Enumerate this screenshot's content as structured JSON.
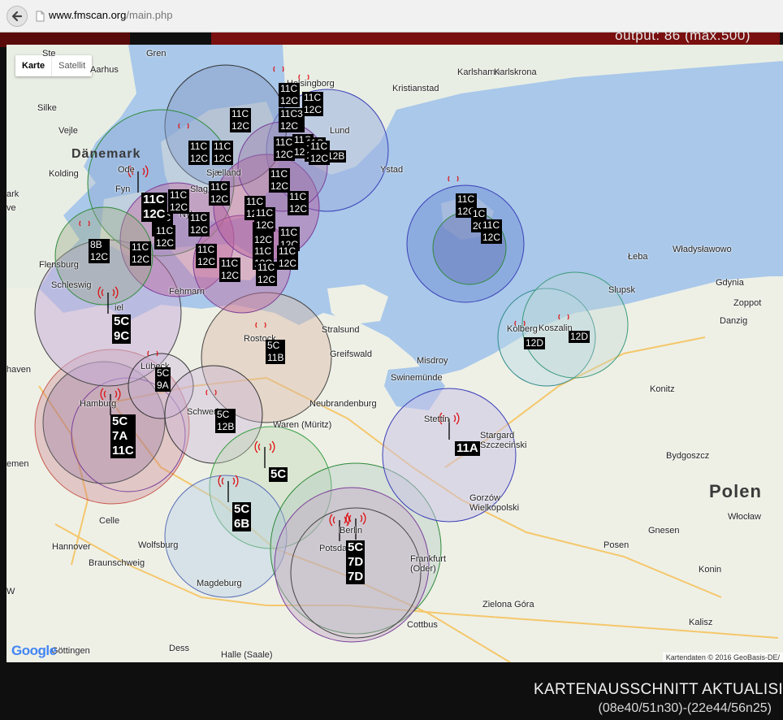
{
  "browser": {
    "url_domain": "www.fmscan.org",
    "url_path": "/main.php"
  },
  "counter_text": "output: 86 (max.500)",
  "map": {
    "type_buttons": [
      "Karte",
      "Satellit"
    ],
    "active_type": "Karte",
    "google_logo": "Google",
    "attribution": "Kartendaten © 2016 GeoBasis-DE/",
    "places": [
      {
        "id": "aarhus",
        "name": "Aarhus",
        "cls": "city"
      },
      {
        "id": "helsingborg",
        "name": "Helsingborg",
        "cls": "city"
      },
      {
        "id": "kristianstad",
        "name": "Kristianstad",
        "cls": "city"
      },
      {
        "id": "karlshamn",
        "name": "Karlshamn",
        "cls": "city"
      },
      {
        "id": "karlskrona",
        "name": "Karlskrona",
        "cls": "city"
      },
      {
        "id": "danemark",
        "name": "Dänemark",
        "cls": "country"
      },
      {
        "id": "lund",
        "name": "Lund",
        "cls": "city"
      },
      {
        "id": "ystad",
        "name": "Ystad",
        "cls": "city"
      },
      {
        "id": "kolding",
        "name": "Kolding",
        "cls": "city"
      },
      {
        "id": "vejle",
        "name": "Vejle",
        "cls": "city"
      },
      {
        "id": "flensburg",
        "name": "Flensburg",
        "cls": "city"
      },
      {
        "id": "schleswig",
        "name": "Schleswig",
        "cls": "city"
      },
      {
        "id": "fehmarn",
        "name": "Fehmarn",
        "cls": "city"
      },
      {
        "id": "stralsund",
        "name": "Stralsund",
        "cls": "city"
      },
      {
        "id": "greifswald",
        "name": "Greifswald",
        "cls": "city"
      },
      {
        "id": "rostock",
        "name": "Rostock",
        "cls": "city"
      },
      {
        "id": "lubeck",
        "name": "Lübeck",
        "cls": "city"
      },
      {
        "id": "hamburg",
        "name": "Hamburg",
        "cls": "city"
      },
      {
        "id": "schwerin",
        "name": "Schwerin",
        "cls": "city"
      },
      {
        "id": "neubrandenburg",
        "name": "Neubrandenburg",
        "cls": "city"
      },
      {
        "id": "waren",
        "name": "Waren (Müritz)",
        "cls": "city"
      },
      {
        "id": "swinemunde",
        "name": "Swinemünde",
        "cls": "city"
      },
      {
        "id": "misdroy",
        "name": "Misdroy",
        "cls": "city"
      },
      {
        "id": "stettin",
        "name": "Stettin",
        "cls": "city"
      },
      {
        "id": "stargard",
        "name": "Stargard\nSzczeciński",
        "cls": "city"
      },
      {
        "id": "kolberg",
        "name": "Kolberg",
        "cls": "city"
      },
      {
        "id": "koszalin",
        "name": "Koszalin",
        "cls": "city"
      },
      {
        "id": "slupsk",
        "name": "Slupsk",
        "cls": "city"
      },
      {
        "id": "gdynia",
        "name": "Gdynia",
        "cls": "city"
      },
      {
        "id": "zoppot",
        "name": "Zoppot",
        "cls": "city"
      },
      {
        "id": "danzig",
        "name": "Danzig",
        "cls": "city"
      },
      {
        "id": "wladyslawowo",
        "name": "Władysławowo",
        "cls": "city"
      },
      {
        "id": "leba",
        "name": "Łeba",
        "cls": "city"
      },
      {
        "id": "konitz",
        "name": "Konitz",
        "cls": "city"
      },
      {
        "id": "bydgoszcz",
        "name": "Bydgoszcz",
        "cls": "city"
      },
      {
        "id": "polen",
        "name": "Polen",
        "cls": "country"
      },
      {
        "id": "wloclaw",
        "name": "Włocław",
        "cls": "city"
      },
      {
        "id": "gnesen",
        "name": "Gnesen",
        "cls": "city"
      },
      {
        "id": "posen",
        "name": "Posen",
        "cls": "city"
      },
      {
        "id": "konin",
        "name": "Konin",
        "cls": "city"
      },
      {
        "id": "kalisz",
        "name": "Kalisz",
        "cls": "city"
      },
      {
        "id": "gorzow",
        "name": "Gorzów\nWielkopolski",
        "cls": "city"
      },
      {
        "id": "frankfurt",
        "name": "Frankfurt\n(Oder)",
        "cls": "city"
      },
      {
        "id": "berlin",
        "name": "Berlin",
        "cls": "city"
      },
      {
        "id": "potsdam",
        "name": "Potsdam",
        "cls": "city"
      },
      {
        "id": "zielona",
        "name": "Zielona Góra",
        "cls": "city"
      },
      {
        "id": "cottbus",
        "name": "Cottbus",
        "cls": "city"
      },
      {
        "id": "magdeburg",
        "name": "Magdeburg",
        "cls": "city"
      },
      {
        "id": "wolfsburg",
        "name": "Wolfsburg",
        "cls": "city"
      },
      {
        "id": "braunschweig",
        "name": "Braunschweig",
        "cls": "city"
      },
      {
        "id": "hannover",
        "name": "Hannover",
        "cls": "city"
      },
      {
        "id": "celle",
        "name": "Celle",
        "cls": "city"
      },
      {
        "id": "bremen",
        "name": "emen",
        "cls": "city"
      },
      {
        "id": "gottingen",
        "name": "Göttingen",
        "cls": "city"
      },
      {
        "id": "halle",
        "name": "Halle (Saale)",
        "cls": "city"
      },
      {
        "id": "odense",
        "name": "Ode",
        "cls": "city"
      },
      {
        "id": "fyn",
        "name": "Fyn",
        "cls": "city"
      },
      {
        "id": "slag",
        "name": "Slag",
        "cls": "city"
      },
      {
        "id": "sjaelland",
        "name": "Sjælland",
        "cls": "city"
      },
      {
        "id": "nyk",
        "name": "Nyk",
        "cls": "city"
      },
      {
        "id": "grenaa",
        "name": "Gren",
        "cls": "city"
      },
      {
        "id": "silkeborg",
        "name": "Silke",
        "cls": "city"
      },
      {
        "id": "hav",
        "name": "haven",
        "cls": "city"
      },
      {
        "id": "dess",
        "name": "Dess",
        "cls": "city"
      },
      {
        "id": "ste",
        "name": "Ste",
        "cls": "city"
      },
      {
        "id": "iel",
        "name": "iel",
        "cls": "city"
      },
      {
        "id": "ve",
        "name": "ve",
        "cls": "city"
      },
      {
        "id": "ark",
        "name": "ark",
        "cls": "city"
      },
      {
        "id": "w",
        "name": "W",
        "cls": "city"
      }
    ],
    "stations": [
      {
        "id": "s1",
        "lines": [
          "11C",
          "12C"
        ]
      },
      {
        "id": "s2",
        "lines": [
          "11C",
          "12C"
        ]
      },
      {
        "id": "s3",
        "lines": [
          "11C",
          "12C"
        ]
      },
      {
        "id": "s4",
        "lines": [
          "11C",
          "12C"
        ]
      },
      {
        "id": "s5",
        "lines": [
          "11C",
          "12C"
        ]
      },
      {
        "id": "s6",
        "lines": [
          "11C",
          "12C"
        ]
      },
      {
        "id": "s7",
        "lines": [
          "11C3",
          "12C"
        ]
      },
      {
        "id": "s8",
        "lines": [
          "11C",
          "12C"
        ]
      },
      {
        "id": "s9",
        "lines": [
          "11C",
          "12C"
        ]
      },
      {
        "id": "s10",
        "lines": [
          "11C",
          "12C"
        ]
      },
      {
        "id": "s11",
        "lines": [
          "11C",
          "12C"
        ]
      },
      {
        "id": "s12",
        "lines": [
          "11C",
          "12C"
        ]
      },
      {
        "id": "s13",
        "lines": [
          "11C",
          "12C"
        ]
      },
      {
        "id": "s14",
        "lines": [
          "11C",
          "12C"
        ]
      },
      {
        "id": "s15",
        "lines": [
          "11C",
          "12C"
        ]
      },
      {
        "id": "s16",
        "lines": [
          "11C",
          "12C"
        ]
      },
      {
        "id": "s17",
        "lines": [
          "11C",
          "12C"
        ]
      },
      {
        "id": "s18",
        "lines": [
          "11C",
          "12C"
        ]
      },
      {
        "id": "s19",
        "lines": [
          "11C",
          "12C"
        ]
      },
      {
        "id": "s20",
        "lines": [
          "11C",
          "12C"
        ]
      },
      {
        "id": "s21",
        "lines": [
          "11C",
          "12C"
        ]
      },
      {
        "id": "s22",
        "lines": [
          "11C",
          "12C"
        ]
      },
      {
        "id": "s23",
        "lines": [
          "12B"
        ]
      },
      {
        "id": "s24",
        "lines": [
          "8B",
          "12C"
        ]
      },
      {
        "id": "s25",
        "lines": [
          "11C",
          "12C"
        ]
      },
      {
        "id": "s26",
        "lines": [
          "11C",
          "12C"
        ]
      },
      {
        "id": "s27",
        "lines": [
          "11C",
          "12C"
        ]
      },
      {
        "id": "s28",
        "lines": [
          "11C",
          "12C"
        ]
      },
      {
        "id": "s29",
        "lines": [
          "11C",
          "12C"
        ]
      },
      {
        "id": "s30",
        "lines": [
          "11C",
          "12C"
        ]
      },
      {
        "id": "s31",
        "lines": [
          "11C",
          "12C"
        ]
      },
      {
        "id": "s32",
        "lines": [
          "5C",
          "9C"
        ]
      },
      {
        "id": "s33",
        "lines": [
          "5C",
          "11B"
        ]
      },
      {
        "id": "s34",
        "lines": [
          "5C",
          "9A"
        ]
      },
      {
        "id": "s35",
        "lines": [
          "5C",
          "7A",
          "11C"
        ]
      },
      {
        "id": "s36",
        "lines": [
          "5C",
          "12B"
        ]
      },
      {
        "id": "s37",
        "lines": [
          "5C"
        ]
      },
      {
        "id": "s38",
        "lines": [
          "5C",
          "6B"
        ]
      },
      {
        "id": "s39",
        "lines": [
          "5C",
          "7D",
          "7D"
        ]
      },
      {
        "id": "s40",
        "lines": [
          "11A"
        ]
      },
      {
        "id": "s41",
        "lines": [
          "12D"
        ]
      },
      {
        "id": "s42",
        "lines": [
          "12D"
        ]
      },
      {
        "id": "s43",
        "lines": [
          "11C",
          "12C"
        ]
      },
      {
        "id": "s44",
        "lines": [
          "1C",
          "2C"
        ]
      },
      {
        "id": "s45",
        "lines": [
          "11C",
          "12C"
        ]
      }
    ]
  },
  "footer": {
    "title": "KARTENAUSSCHNITT AKTUALISI",
    "coords": "(08e40/51n30)-(22e44/56n25)"
  }
}
